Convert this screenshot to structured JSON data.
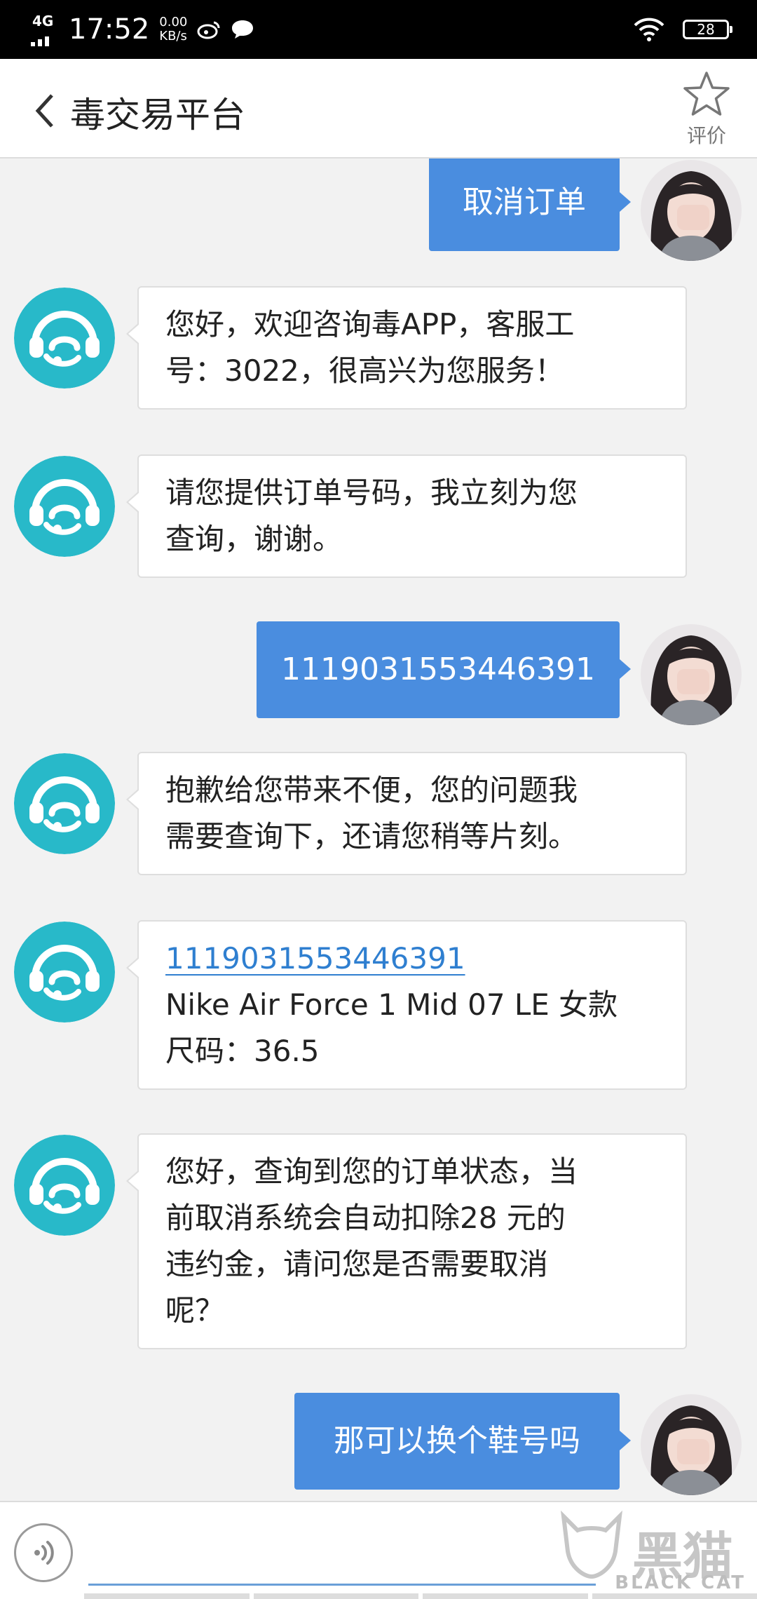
{
  "status_bar": {
    "network": "4G",
    "time": "17:52",
    "speed_value": "0.00",
    "speed_unit": "KB/s",
    "battery": "28"
  },
  "header": {
    "title": "毒交易平台",
    "rate_label": "评价"
  },
  "messages": [
    {
      "from": "user",
      "text": "取消订单"
    },
    {
      "from": "agent",
      "lines": [
        "您好，欢迎咨询毒APP，客服工",
        "号：3022，很高兴为您服务！"
      ]
    },
    {
      "from": "agent",
      "lines": [
        "请您提供订单号码，我立刻为您",
        "查询，谢谢。"
      ]
    },
    {
      "from": "user",
      "text": "1119031553446391"
    },
    {
      "from": "agent",
      "lines": [
        "抱歉给您带来不便，您的问题我",
        "需要查询下，还请您稍等片刻。"
      ]
    },
    {
      "from": "agent",
      "link": "1119031553446391",
      "lines": [
        "Nike Air Force 1 Mid 07 LE 女款",
        "尺码：36.5"
      ]
    },
    {
      "from": "agent",
      "lines": [
        "您好，查询到您的订单状态，当",
        "前取消系统会自动扣除28  元的",
        "违约金，请问您是否需要取消",
        "呢？"
      ]
    },
    {
      "from": "user",
      "text": "那可以换个鞋号吗"
    }
  ],
  "input": {
    "value": "",
    "placeholder": ""
  },
  "watermark": {
    "big": "黑猫",
    "small": "BLACK CAT"
  },
  "colors": {
    "user_bubble": "#4a8ddf",
    "agent_avatar": "#28b9c9",
    "link": "#2f7fd0"
  },
  "icons": [
    "back-arrow-icon",
    "star-icon",
    "agent-headset-icon",
    "voice-icon",
    "weibo-icon",
    "chat-icon",
    "wifi-icon"
  ]
}
